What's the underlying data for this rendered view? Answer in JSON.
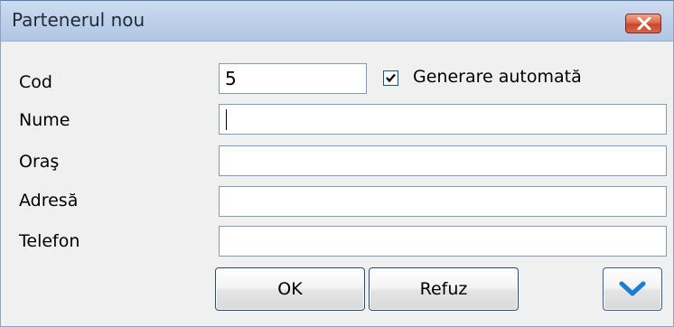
{
  "window": {
    "title": "Partenerul nou"
  },
  "form": {
    "cod": {
      "label": "Cod",
      "value": "5"
    },
    "auto_generate": {
      "label": "Generare automată",
      "checked": true
    },
    "nume": {
      "label": "Nume",
      "value": ""
    },
    "oras": {
      "label": "Oraş",
      "value": ""
    },
    "adresa": {
      "label": "Adresă",
      "value": ""
    },
    "telefon": {
      "label": "Telefon",
      "value": ""
    }
  },
  "buttons": {
    "ok_label": "OK",
    "cancel_label": "Refuz",
    "more_icon": "chevron-down-icon"
  },
  "colors": {
    "titlebar": "#bfd1ea",
    "close_button": "#d7664a",
    "chevron": "#1a7fd0",
    "field_border": "#7f9db9"
  }
}
